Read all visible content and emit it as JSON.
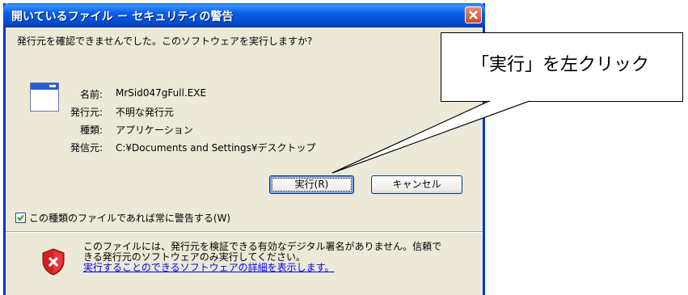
{
  "dialog": {
    "title": "開いているファイル － セキュリティの警告",
    "question": "発行元を確認できませんでした。このソフトウェアを実行しますか?",
    "fields": [
      {
        "label": "名前:",
        "value": "MrSid047gFull.EXE"
      },
      {
        "label": "発行元:",
        "value": "不明な発行元"
      },
      {
        "label": "種類:",
        "value": "アプリケーション"
      },
      {
        "label": "発信元:",
        "value": "C:¥Documents and Settings¥デスクトップ"
      }
    ],
    "run_button": "実行(R)",
    "cancel_button": "キャンセル",
    "checkbox_label": "この種類のファイルであれば常に警告する(W)",
    "checkbox_checked": true,
    "warning_line1": "このファイルには、発行元を検証できる有効なデジタル署名がありません。信頼で",
    "warning_line2": "きる発行元のソフトウェアのみ実行してください。",
    "warning_link": "実行することのできるソフトウェアの詳細を表示します。"
  },
  "callout": {
    "text": "「実行」を左クリック"
  },
  "icons": {
    "app": "application-window-icon",
    "shield": "security-shield-icon",
    "close": "close-icon"
  },
  "colors": {
    "title_bar": "#0860e8",
    "dialog_bg": "#ece9d8",
    "shield_red": "#d42020",
    "link": "#0000ee"
  }
}
